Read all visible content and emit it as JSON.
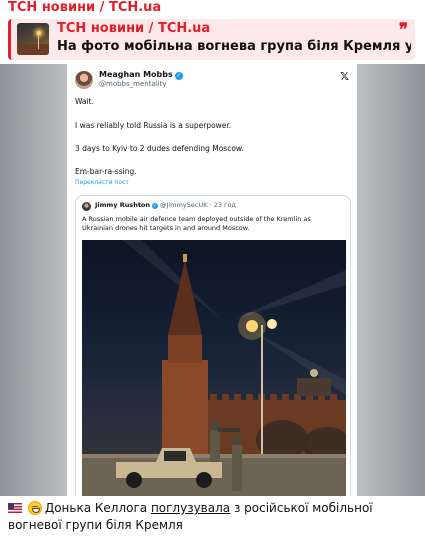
{
  "channel": {
    "title": "ТСН новини / TCH.ua"
  },
  "reply": {
    "author": "ТСН новини / TCH.ua",
    "text": "На фото мобільна вогнева група біля Кремля у Москв"
  },
  "tweet": {
    "author_name": "Meaghan Mobbs",
    "author_handle": "@mobbs_mentality",
    "lines": [
      "Wait.",
      "I was reliably told Russia is a superpower.",
      "3 days to Kyiv to 2 dudes defending Moscow.",
      "Em-bar-ra-ssing."
    ],
    "translate_label": "Перекласти пост",
    "quoted": {
      "author_name": "Jimmy Rushton",
      "author_handle": "@JimmySecUK",
      "time": "· 23 год",
      "lines": [
        "A Russian mobile air defence team deployed outside of the Kremlin as",
        "Ukrainian drones hit targets in and around Moscow."
      ]
    }
  },
  "caption": {
    "before_link": "Донька Келлога ",
    "link": "поглузувала",
    "after_link": " з російської мобільної вогневої групи біля Кремля"
  },
  "colors": {
    "accent": "#e0202a",
    "reply_bg": "#fde9ea",
    "link_blue": "#1d9bf0"
  }
}
